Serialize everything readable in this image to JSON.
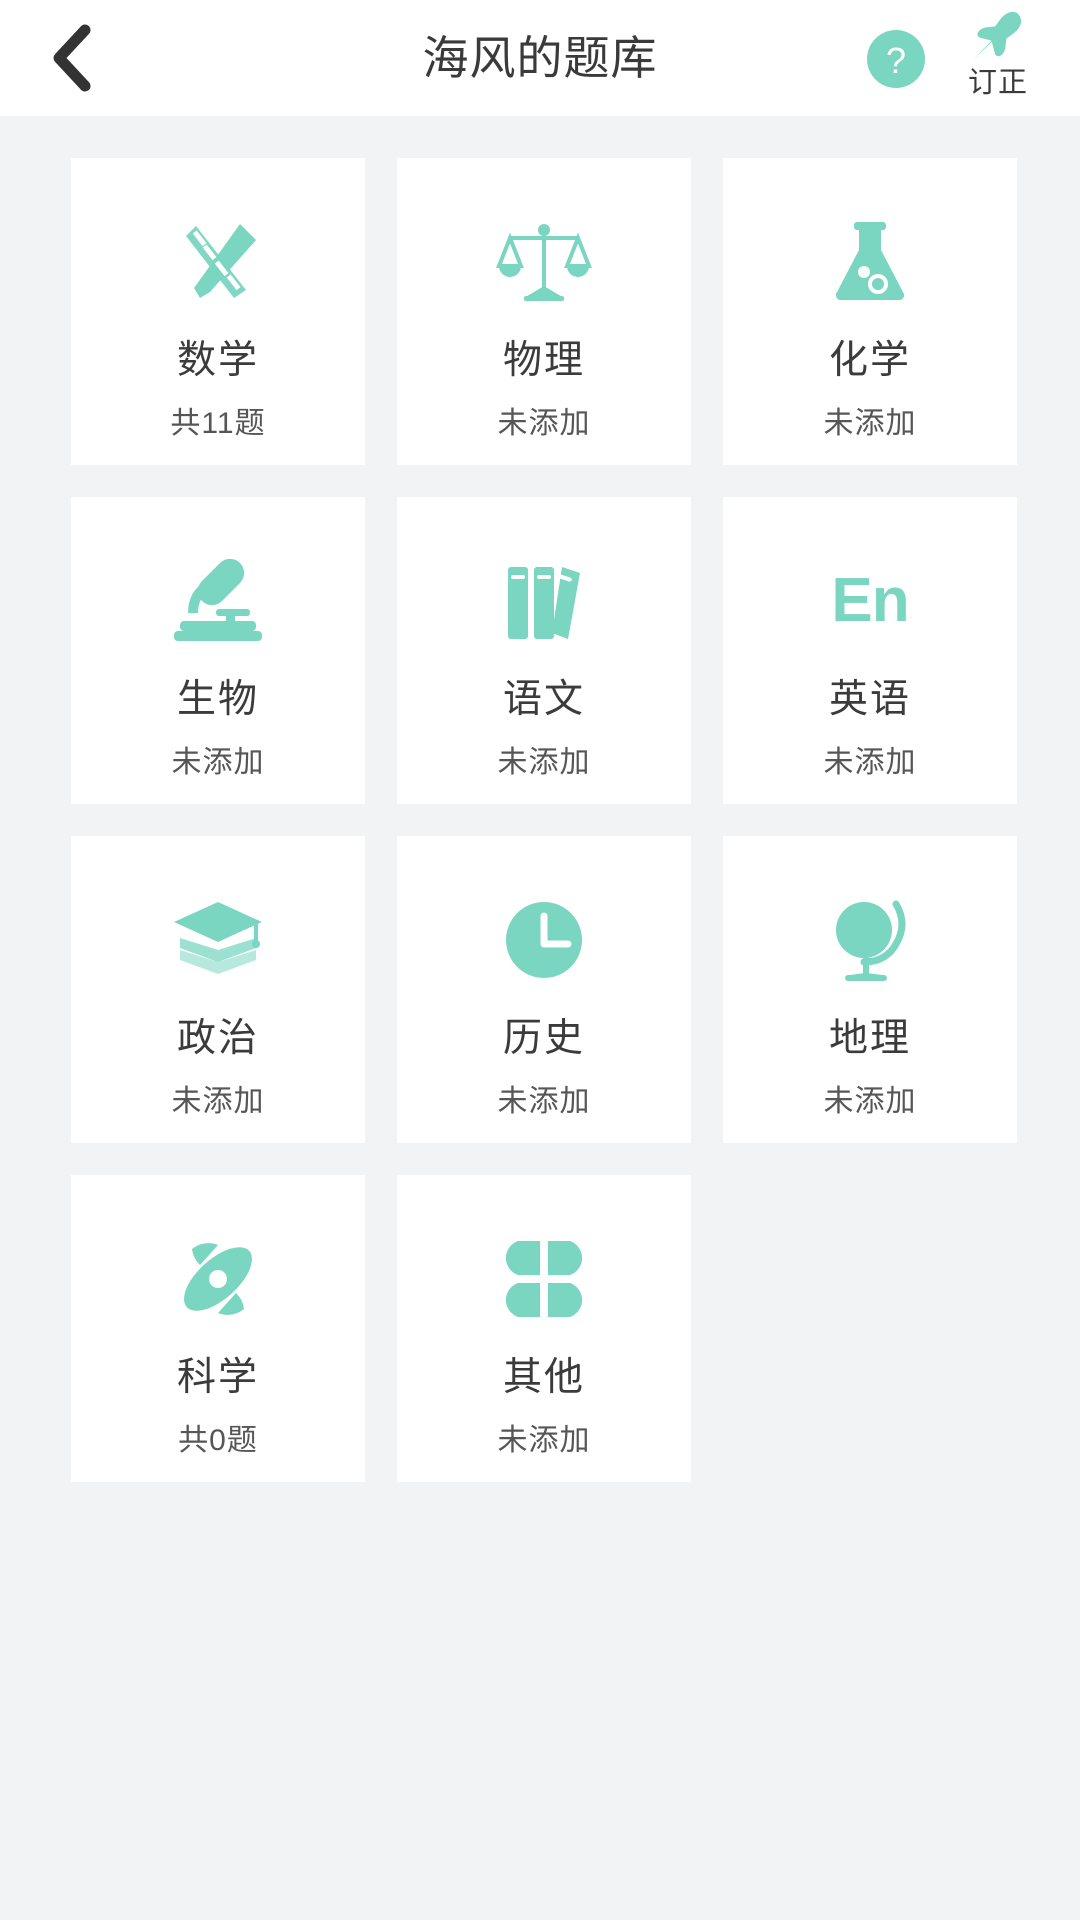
{
  "colors": {
    "accent": "#7ad5c1",
    "page_background": "#f2f3f4",
    "card_background": "#ffffff",
    "title_text": "#3a3a3a",
    "sub_text": "#565656"
  },
  "header": {
    "title": "海风的题库",
    "back_icon": "chevron-left-icon",
    "help_icon": "question-mark-circle-icon",
    "help_glyph": "?",
    "pin_icon": "pushpin-icon",
    "pin_label": "订正"
  },
  "grid": {
    "columns": 3,
    "cards": [
      {
        "name": "数学",
        "count": "共11题",
        "icon": "pencil-ruler-icon"
      },
      {
        "name": "物理",
        "count": "未添加",
        "icon": "balance-scale-icon"
      },
      {
        "name": "化学",
        "count": "未添加",
        "icon": "flask-icon"
      },
      {
        "name": "生物",
        "count": "未添加",
        "icon": "microscope-icon"
      },
      {
        "name": "语文",
        "count": "未添加",
        "icon": "books-icon"
      },
      {
        "name": "英语",
        "count": "未添加",
        "icon": "en-text-icon",
        "icon_text": "En"
      },
      {
        "name": "政治",
        "count": "未添加",
        "icon": "graduation-cap-book-icon"
      },
      {
        "name": "历史",
        "count": "未添加",
        "icon": "clock-icon"
      },
      {
        "name": "地理",
        "count": "未添加",
        "icon": "globe-stand-icon"
      },
      {
        "name": "科学",
        "count": "共0题",
        "icon": "atom-orbit-icon"
      },
      {
        "name": "其他",
        "count": "未添加",
        "icon": "four-petal-icon"
      }
    ]
  }
}
